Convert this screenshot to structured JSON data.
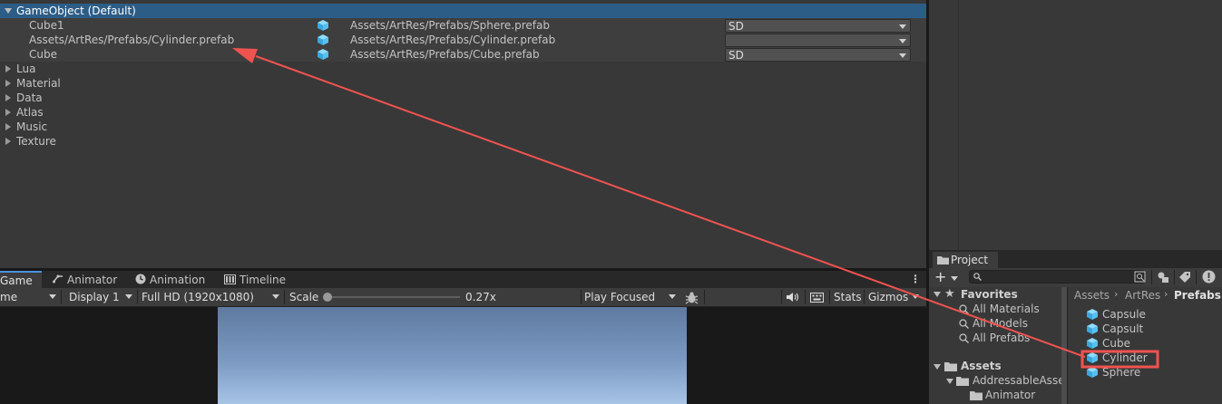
{
  "addressables": {
    "group_title": "GameObject (Default)",
    "entries": [
      {
        "name": "Cube1",
        "path": "Assets/ArtRes/Prefabs/Sphere.prefab",
        "label": "SD"
      },
      {
        "name": "Assets/ArtRes/Prefabs/Cylinder.prefab",
        "path": "Assets/ArtRes/Prefabs/Cylinder.prefab",
        "label": ""
      },
      {
        "name": "Cube",
        "path": "Assets/ArtRes/Prefabs/Cube.prefab",
        "label": "SD"
      }
    ],
    "groups": [
      "Lua",
      "Material",
      "Data",
      "Atlas",
      "Music",
      "Texture"
    ]
  },
  "game_view": {
    "tabs": [
      "Game",
      "Animator",
      "Animation",
      "Timeline"
    ],
    "toolbar": {
      "game_dropdown": "me",
      "display": "Display 1",
      "resolution": "Full HD (1920x1080)",
      "scale_label": "Scale",
      "scale_value": "0.27x",
      "scale_fraction": 0.0,
      "play_mode": "Play Focused",
      "stats": "Stats",
      "gizmos": "Gizmos"
    }
  },
  "project": {
    "tab": "Project",
    "favorites_title": "Favorites",
    "favorites": [
      "All Materials",
      "All Models",
      "All Prefabs"
    ],
    "assets_title": "Assets",
    "assets_tree": [
      "AddressableAsse",
      "Animator"
    ],
    "breadcrumb": [
      "Assets",
      "ArtRes",
      "Prefabs"
    ],
    "files": [
      "Capsule",
      "Capsult",
      "Cube",
      "Cylinder",
      "Sphere"
    ]
  },
  "colors": {
    "annotation_red": "#ef5350",
    "selection_blue": "#2c5d87",
    "cube_icon": "#56c1f0"
  }
}
